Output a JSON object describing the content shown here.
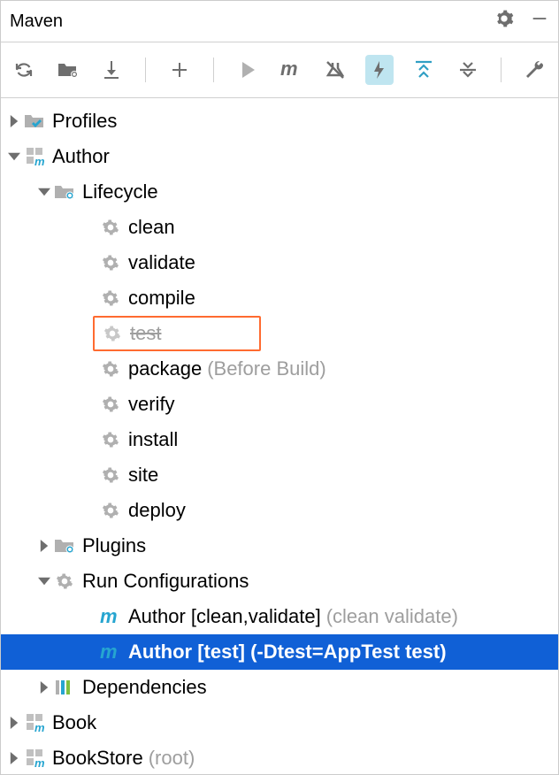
{
  "header": {
    "title": "Maven"
  },
  "tree": {
    "profiles": "Profiles",
    "author": "Author",
    "lifecycle": "Lifecycle",
    "phases": {
      "clean": "clean",
      "validate": "validate",
      "compile": "compile",
      "test": "test",
      "package": "package",
      "package_ann": "(Before Build)",
      "verify": "verify",
      "install": "install",
      "site": "site",
      "deploy": "deploy"
    },
    "plugins": "Plugins",
    "runconfigs": "Run Configurations",
    "rc1": "Author [clean,validate]",
    "rc1_ann": "(clean validate)",
    "rc2": "Author [test] (-Dtest=AppTest test)",
    "dependencies": "Dependencies",
    "book": "Book",
    "bookstore": "BookStore",
    "bookstore_ann": "(root)"
  }
}
